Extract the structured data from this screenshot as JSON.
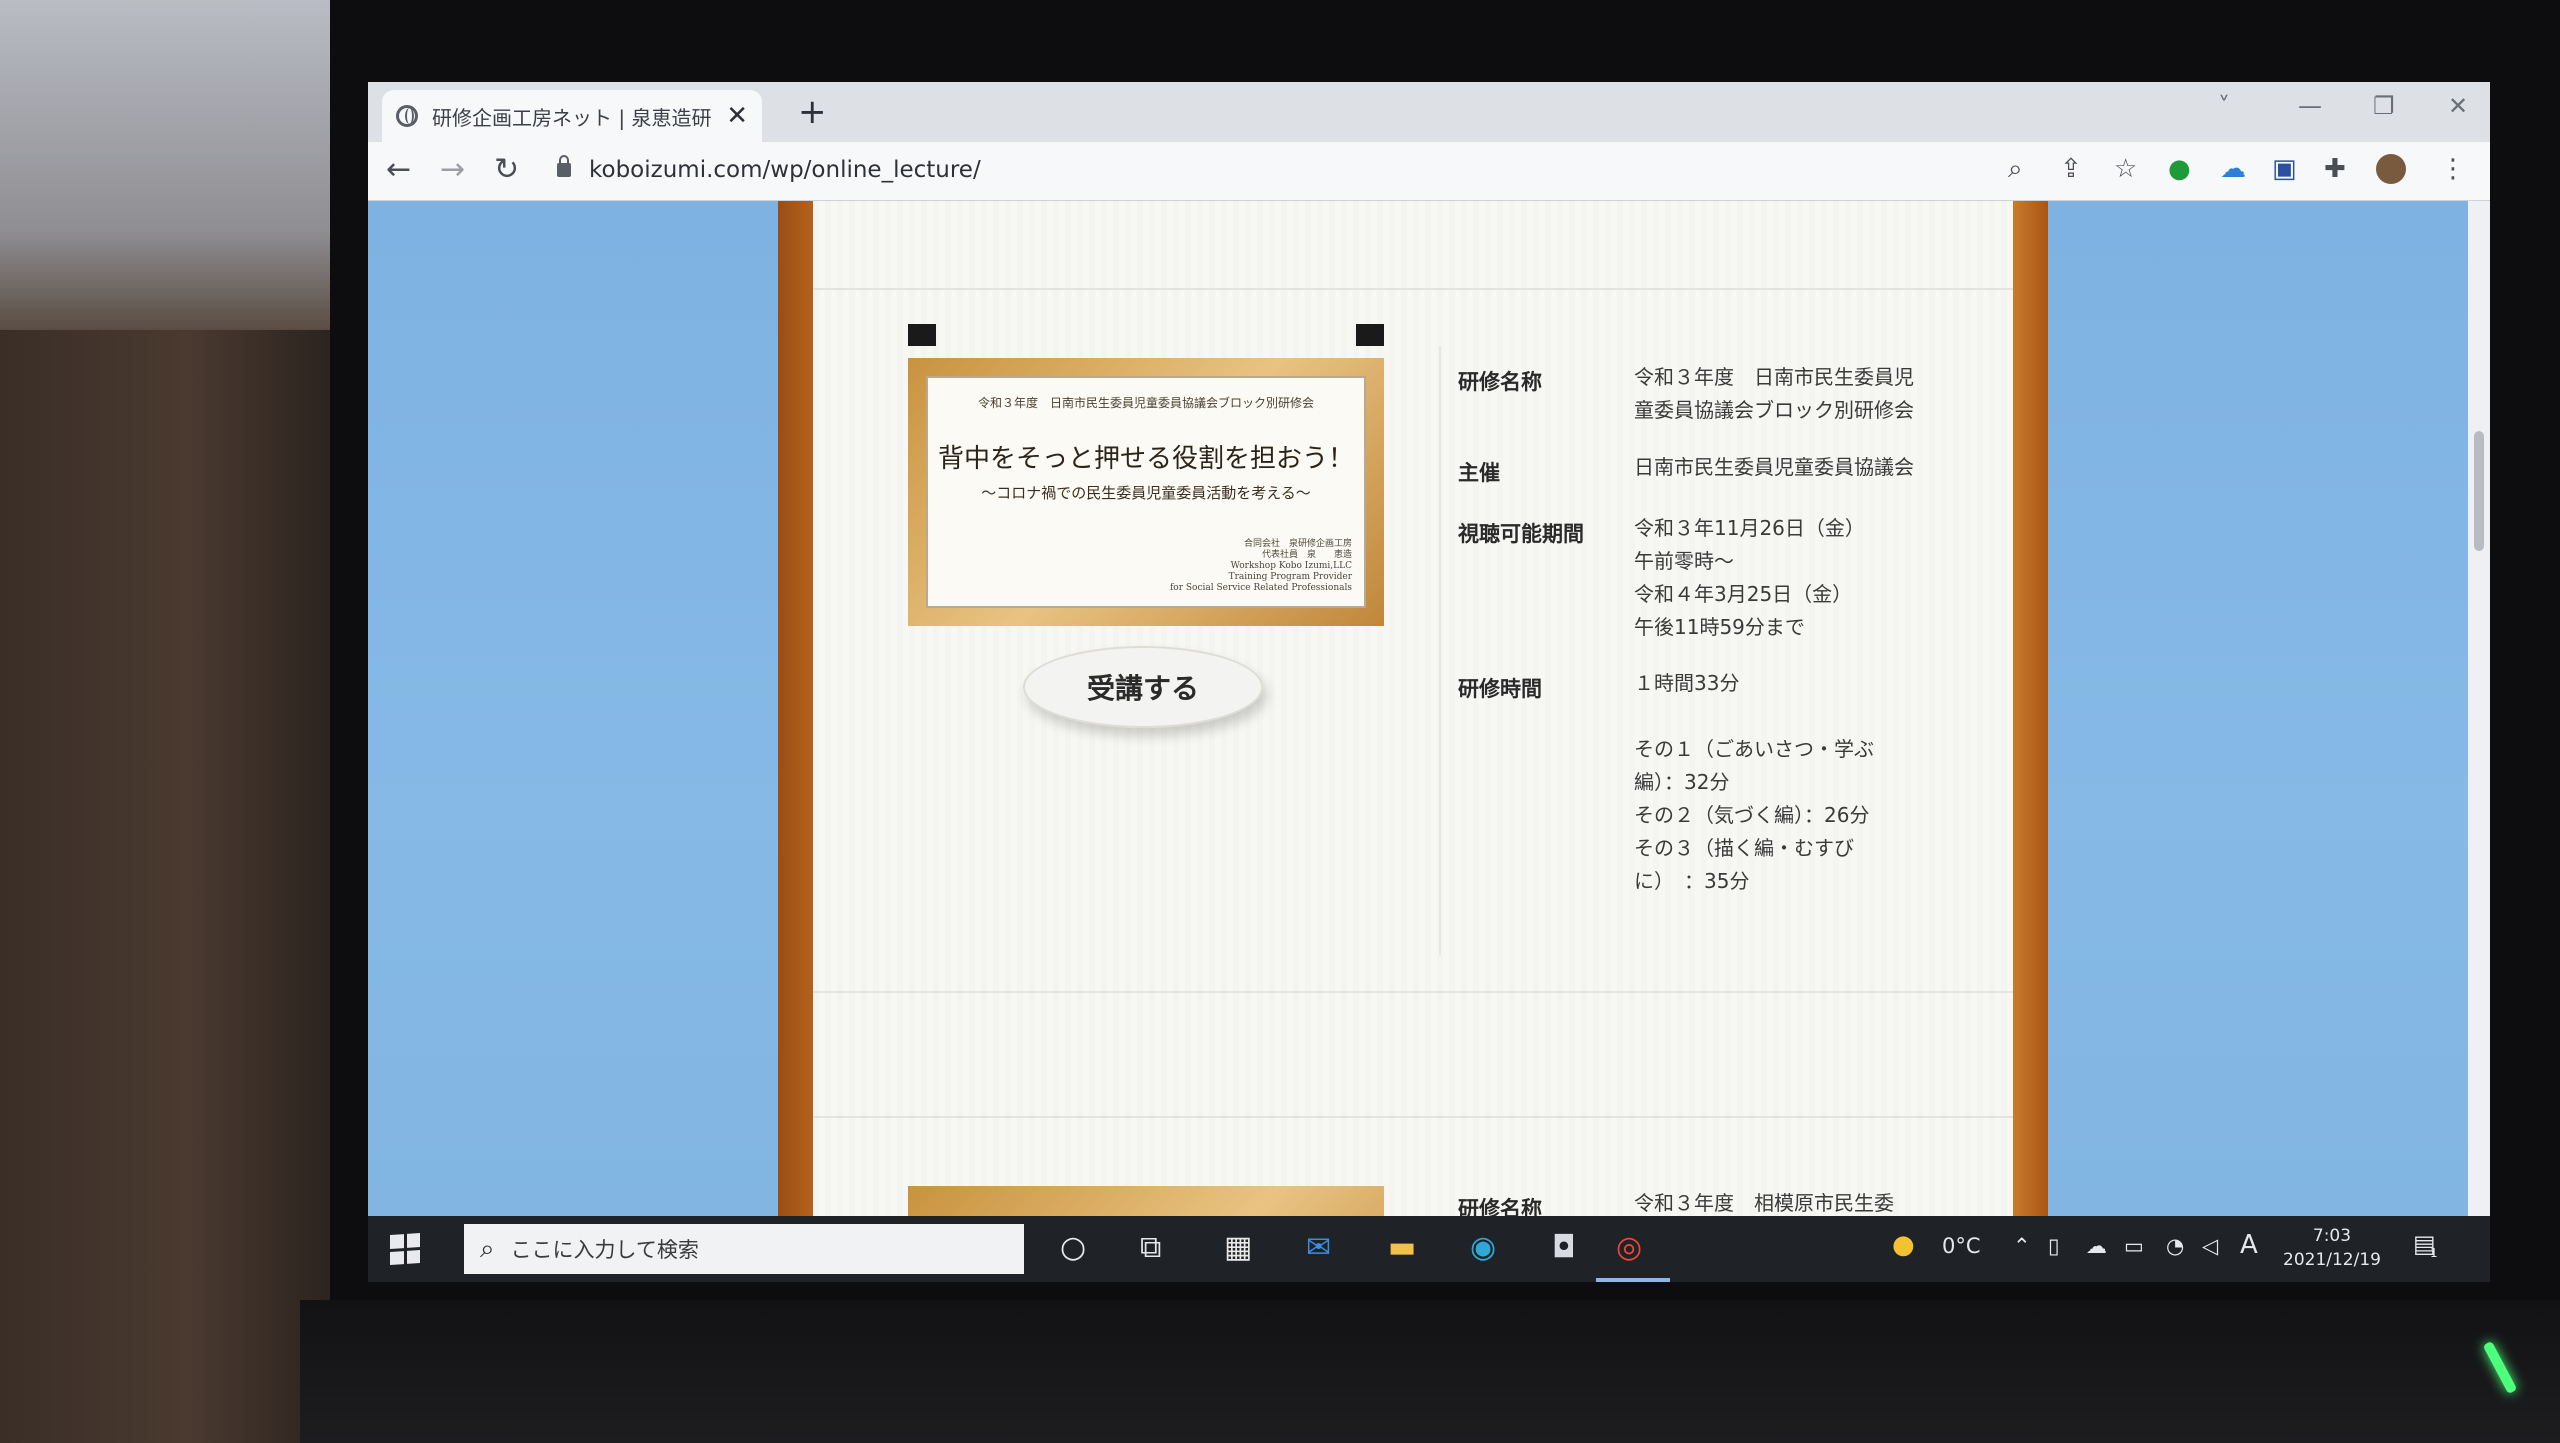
{
  "browser": {
    "tab_title": "研修企画工房ネット | 泉恵造研修",
    "new_tab": "+",
    "url": "koboizumi.com/wp/online_lecture/",
    "window_controls": [
      "˅",
      "—",
      "❐",
      "✕"
    ]
  },
  "toolbar_icons": [
    "back-icon",
    "forward-icon",
    "reload-icon",
    "lock-icon",
    "zoom-icon",
    "share-icon",
    "star-icon",
    "extension-green-icon",
    "cloud-extension-icon",
    "extension-puzzle-icon",
    "profile-avatar",
    "menu-icon"
  ],
  "lecture": {
    "thumbnail": {
      "top_line": "令和３年度　日南市民生委員児童委員協議会ブロック別研修会",
      "title": "背中をそっと押せる役割を担おう！",
      "subtitle": "～コロナ禍での民生委員児童委員活動を考える～",
      "footer": "合同会社　泉研修企画工房\n代表社員　泉　　恵造\nWorkshop Kobo Izumi,LLC\nTraining Program Provider\nfor Social Service Related Professionals"
    },
    "enroll_button": "受講する",
    "fields": [
      {
        "label": "研修名称",
        "value": "令和３年度　日南市民生委員児\n童委員協議会ブロック別研修会"
      },
      {
        "label": "主催",
        "value": "日南市民生委員児童委員協議会"
      },
      {
        "label": "視聴可能期間",
        "value": "令和３年11月26日（金）\n午前零時～\n令和４年3月25日（金）\n午後11時59分まで"
      },
      {
        "label": "研修時間",
        "value": "１時間33分"
      },
      {
        "label": "",
        "value": "その１（ごあいさつ・学ぶ\n編）：32分\nその２（気づく編）：26分\nその３（描く編・むすび\nに）　：35分"
      }
    ],
    "next_label": "研修名称",
    "next_value": "令和３年度　相模原市民生委"
  },
  "taskbar": {
    "search_placeholder": "ここに入力して検索",
    "weather": "0°C",
    "ime": "A",
    "time": "7:03",
    "date": "2021/12/19",
    "notification_count": "1"
  }
}
